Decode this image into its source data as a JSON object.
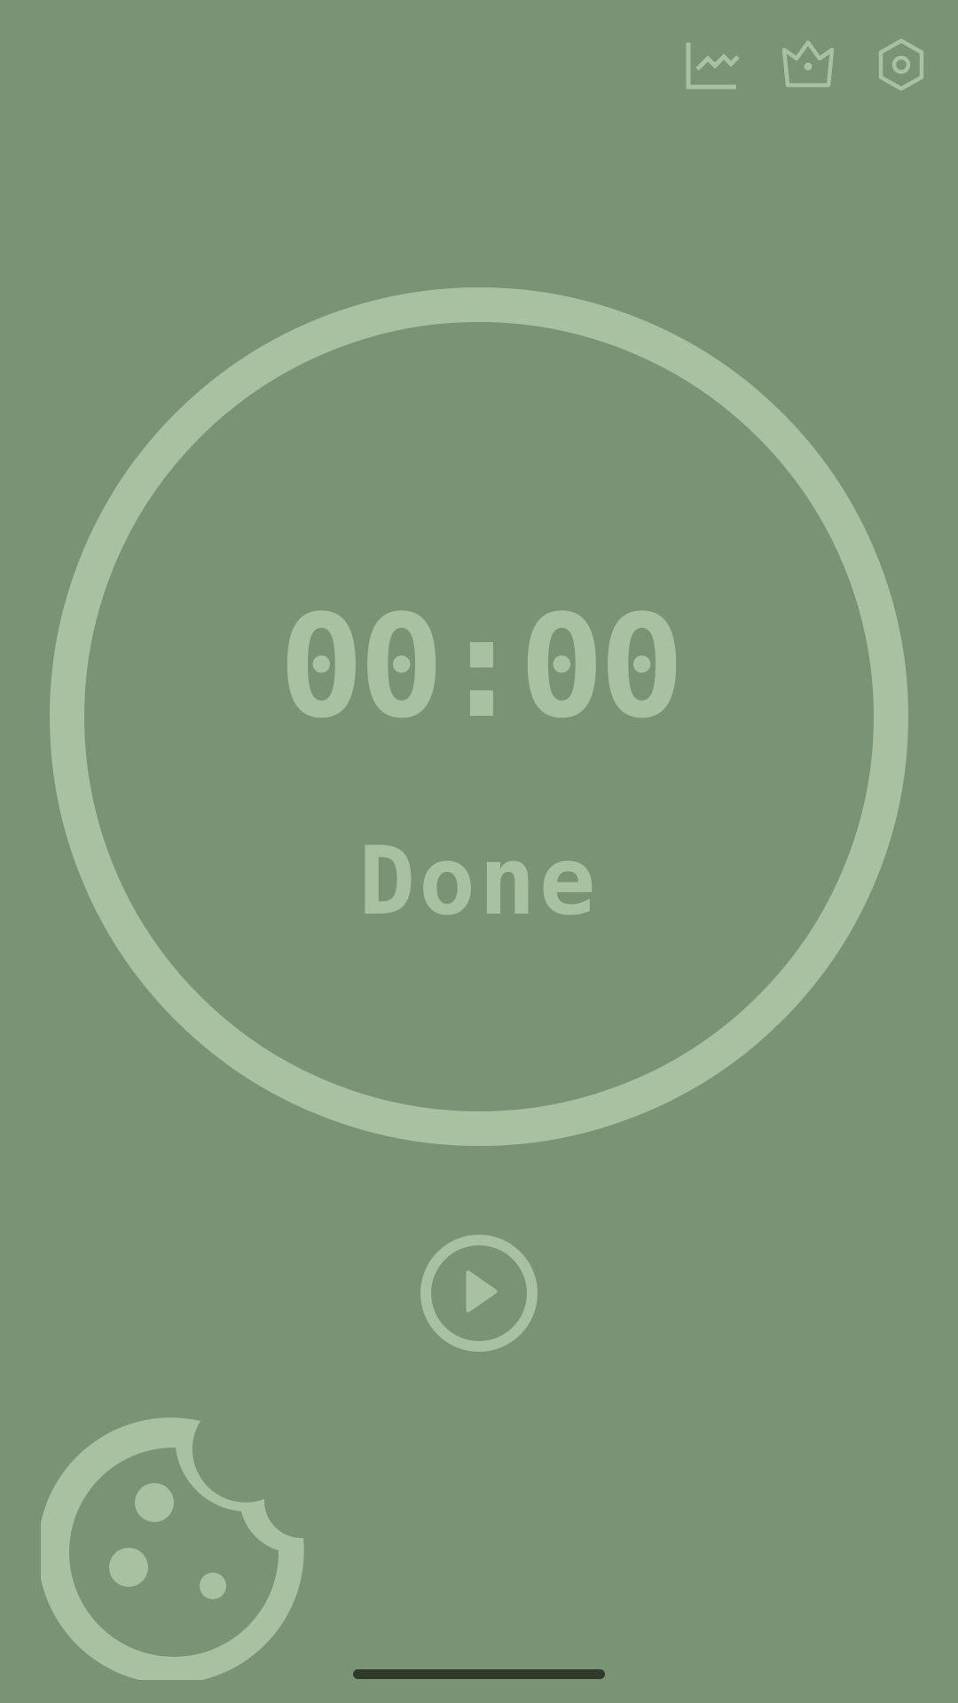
{
  "colors": {
    "background": "#7b9375",
    "accent": "#aac1a1",
    "home_indicator": "#2f3a2b"
  },
  "toolbar": {
    "icons": [
      "chart-icon",
      "crown-icon",
      "settings-icon"
    ]
  },
  "timer": {
    "time": "00:00",
    "status": "Done"
  },
  "controls": {
    "play_icon": "play-icon"
  },
  "decor": {
    "icon": "cookie-icon"
  }
}
